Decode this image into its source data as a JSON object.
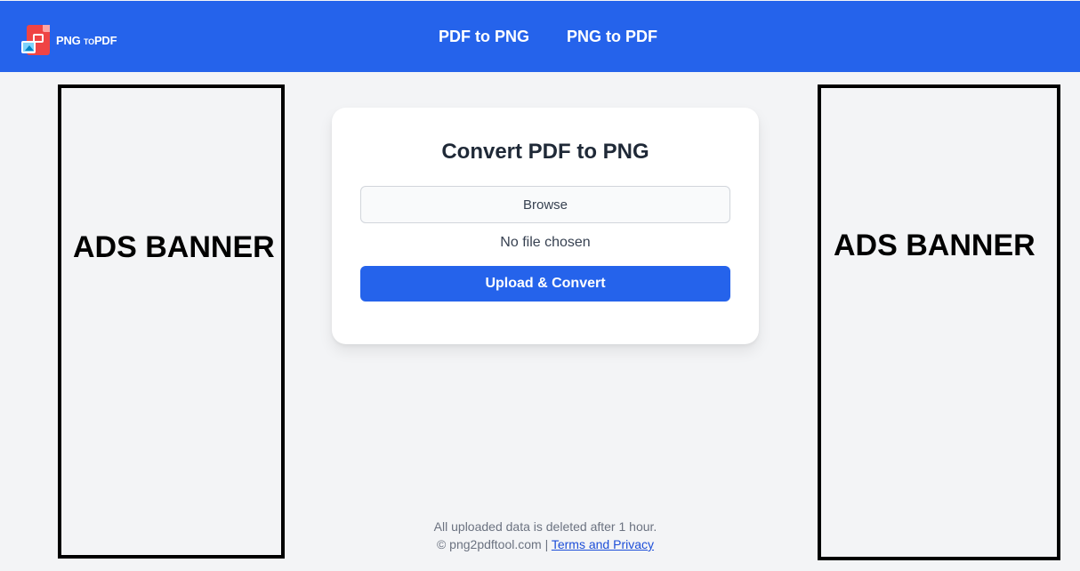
{
  "header": {
    "logo": {
      "text_main": "PNG",
      "text_small": "TO",
      "text_end": "PDF"
    },
    "nav": [
      {
        "label": "PDF to PNG"
      },
      {
        "label": "PNG to PDF"
      }
    ]
  },
  "ads": {
    "left": "ADS BANNER",
    "right": "ADS BANNER"
  },
  "converter": {
    "title": "Convert PDF to PNG",
    "browse_label": "Browse",
    "file_status": "No file chosen",
    "submit_label": "Upload & Convert"
  },
  "footer": {
    "notice": "All uploaded data is deleted after 1 hour.",
    "copyright": "© png2pdftool.com |",
    "terms_link": "Terms and Privacy"
  },
  "colors": {
    "brand": "#2563eb",
    "logo_red": "#ef4444",
    "page_bg": "#f3f4f6",
    "card_bg": "#ffffff"
  }
}
